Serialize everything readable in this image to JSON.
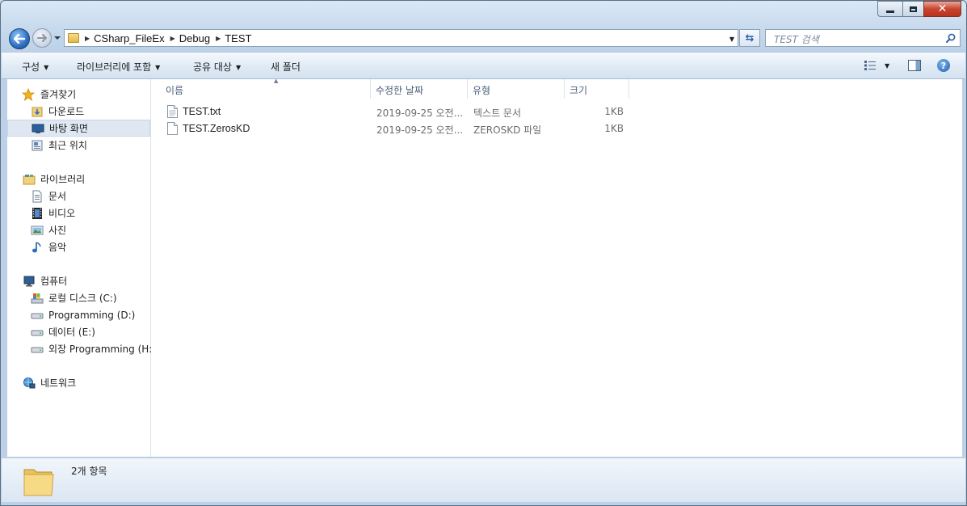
{
  "window": {
    "controls": {
      "minimize_icon": "minimize-icon",
      "maximize_icon": "maximize-icon",
      "close_icon": "close-icon"
    }
  },
  "navigation": {
    "breadcrumb": [
      "CSharp_FileEx",
      "Debug",
      "TEST"
    ],
    "search_placeholder": "TEST 검색"
  },
  "toolbar": {
    "organize": "구성",
    "include_library": "라이브러리에 포함",
    "share_with": "공유 대상",
    "new_folder": "새 폴더"
  },
  "sidebar": {
    "favorites": {
      "label": "즐겨찾기",
      "items": [
        "다운로드",
        "바탕 화면",
        "최근 위치"
      ],
      "selected": "바탕 화면"
    },
    "libraries": {
      "label": "라이브러리",
      "items": [
        "문서",
        "비디오",
        "사진",
        "음악"
      ]
    },
    "computer": {
      "label": "컴퓨터",
      "items": [
        "로컬 디스크 (C:)",
        "Programming (D:)",
        "데이터 (E:)",
        "외장 Programming (H:)"
      ]
    },
    "network": {
      "label": "네트워크"
    }
  },
  "file_list": {
    "columns": [
      "이름",
      "수정한 날짜",
      "유형",
      "크기"
    ],
    "rows": [
      {
        "name": "TEST.txt",
        "modified": "2019-09-25 오전...",
        "type": "텍스트 문서",
        "size": "1KB"
      },
      {
        "name": "TEST.ZerosKD",
        "modified": "2019-09-25 오전...",
        "type": "ZEROSKD 파일",
        "size": "1KB"
      }
    ]
  },
  "status": {
    "item_count": "2개 항목"
  },
  "colors": {
    "accent": "#2f6fc1",
    "close_button": "#c9452f",
    "selection": "#dfe8f2"
  }
}
